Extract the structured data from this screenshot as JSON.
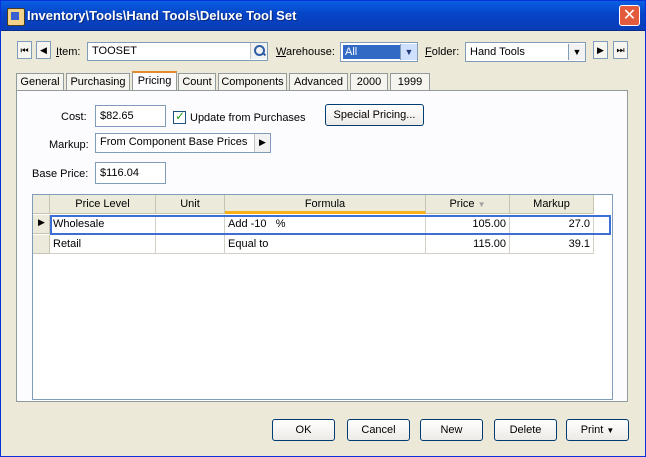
{
  "window": {
    "title": "Inventory\\Tools\\Hand Tools\\Deluxe Tool Set",
    "close": "✕"
  },
  "nav": {
    "first": "⏮",
    "prev": "◀",
    "next": "▶",
    "last": "⏭"
  },
  "item": {
    "label_u": "I",
    "label_rest": "tem:",
    "value": "TOOSET"
  },
  "warehouse": {
    "label_u": "W",
    "label_rest": "arehouse:",
    "value": "All"
  },
  "folder": {
    "label_u": "F",
    "label_rest": "older:",
    "value": "Hand Tools"
  },
  "tabs": [
    "General",
    "Purchasing",
    "Pricing",
    "Count",
    "Components",
    "Advanced",
    "2000",
    "1999"
  ],
  "pricing": {
    "cost_label": "Cost:",
    "cost_value": "$82.65",
    "update_label": "Update from Purchases",
    "special_pricing_label": "Special Pricing...",
    "markup_label": "Markup:",
    "markup_value": "From Component Base Prices",
    "base_price_label": "Base Price:",
    "base_price_value": "$116.04"
  },
  "grid": {
    "columns": [
      "Price Level",
      "Unit",
      "Formula",
      "Price",
      "Markup"
    ],
    "rows": [
      {
        "level": "Wholesale",
        "unit": "",
        "formula": "Add -10   %",
        "price": "105.00",
        "markup": "27.0"
      },
      {
        "level": "Retail",
        "unit": "",
        "formula": "Equal to",
        "price": "115.00",
        "markup": "39.1"
      }
    ]
  },
  "buttons": {
    "ok": "OK",
    "cancel": "Cancel",
    "new": "New",
    "delete": "Delete",
    "print": "Print"
  }
}
